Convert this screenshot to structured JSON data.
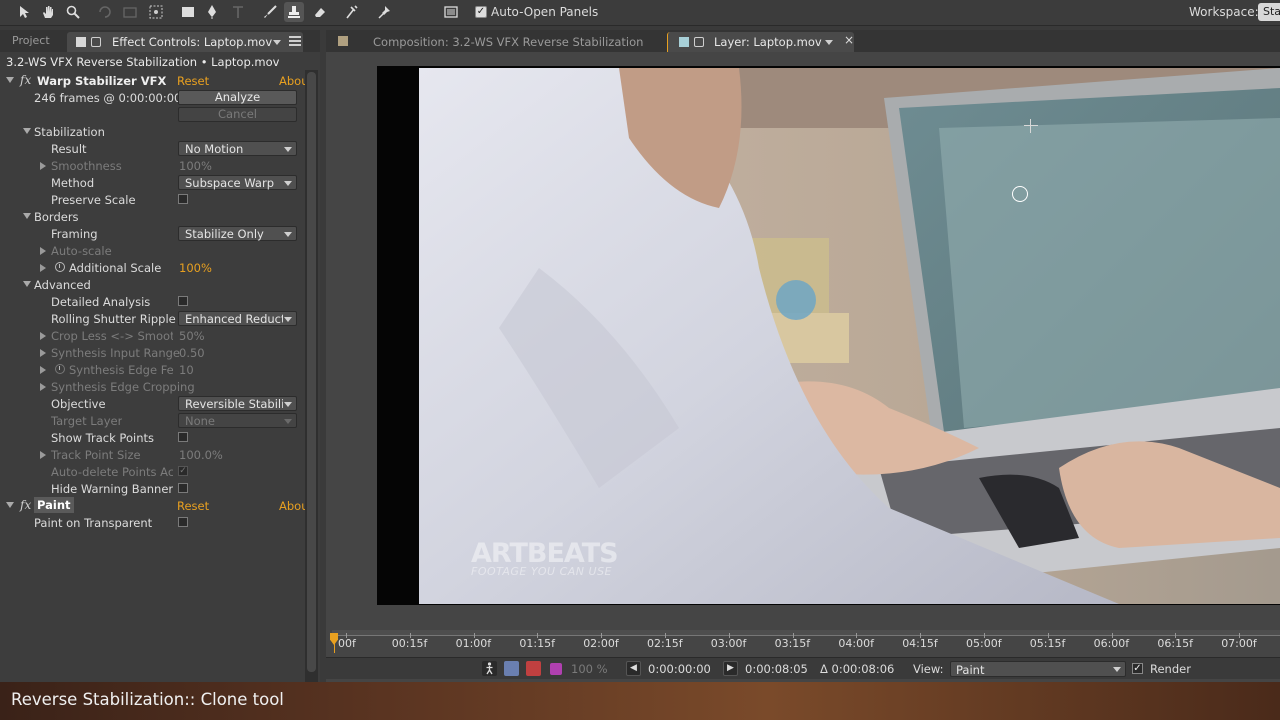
{
  "toolbar": {
    "auto_open_label": "Auto-Open Panels",
    "auto_open_checked": "✓",
    "workspace_label": "Workspace:",
    "workspace_value": "Sta"
  },
  "left_panel": {
    "project_tab": "Project",
    "effect_controls_tab": "Effect Controls: Laptop.mov",
    "header": "3.2-WS VFX Reverse Stabilization • Laptop.mov",
    "warp": {
      "name": "Warp Stabilizer VFX",
      "reset": "Reset",
      "about": "Abou",
      "frames_status": "246 frames @ 0:00:00:00",
      "analyze": "Analyze",
      "cancel": "Cancel"
    },
    "stabilization": {
      "label": "Stabilization",
      "result_label": "Result",
      "result_value": "No Motion",
      "smoothness_label": "Smoothness",
      "smoothness_value": "100%",
      "method_label": "Method",
      "method_value": "Subspace Warp",
      "preserve_scale_label": "Preserve Scale"
    },
    "borders": {
      "label": "Borders",
      "framing_label": "Framing",
      "framing_value": "Stabilize Only",
      "autoscale_label": "Auto-scale",
      "additional_scale_label": "Additional Scale",
      "additional_scale_value": "100%"
    },
    "advanced": {
      "label": "Advanced",
      "detailed_analysis_label": "Detailed Analysis",
      "rolling_shutter_label": "Rolling Shutter Ripple",
      "rolling_shutter_value": "Enhanced Reducti",
      "crop_less_label": "Crop Less <-> Smoot",
      "crop_less_value": "50%",
      "synth_input_label": "Synthesis Input Range",
      "synth_input_value": "0.50",
      "synth_edge_feather_label": "Synthesis Edge Fea",
      "synth_edge_feather_value": "10",
      "synth_edge_cropping_label": "Synthesis Edge Cropping",
      "objective_label": "Objective",
      "objective_value": "Reversible Stabiliz",
      "target_layer_label": "Target Layer",
      "target_layer_value": "None",
      "show_track_points_label": "Show Track Points",
      "track_point_size_label": "Track Point Size",
      "track_point_size_value": "100.0%",
      "auto_delete_label": "Auto-delete Points Acr",
      "auto_delete_check": "✓",
      "hide_warning_label": "Hide Warning Banner"
    },
    "paint": {
      "name": "Paint",
      "reset": "Reset",
      "about": "Abou",
      "paint_on_transparent_label": "Paint on Transparent"
    }
  },
  "right_panel": {
    "composition_tab": "Composition: 3.2-WS VFX Reverse Stabilization",
    "layer_tab": "Layer: Laptop.mov",
    "close": "×",
    "watermark_brand": "ARTBEATS",
    "watermark_tagline": "FOOTAGE YOU CAN USE",
    "timeline_ticks": [
      "00f",
      "00:15f",
      "01:00f",
      "01:15f",
      "02:00f",
      "02:15f",
      "03:00f",
      "03:15f",
      "04:00f",
      "04:15f",
      "05:00f",
      "05:15f",
      "06:00f",
      "06:15f",
      "07:00f",
      "0"
    ],
    "controls": {
      "opacity": "100 %",
      "in_time": "0:00:00:00",
      "out_time": "0:00:08:05",
      "duration": "Δ 0:00:08:06",
      "view_label": "View:",
      "view_value": "Paint",
      "render_label": "Render",
      "render_check": "✓"
    }
  },
  "caption": "Reverse Stabilization:: Clone tool",
  "colors": {
    "accent": "#e8a020",
    "panel_bg": "#3d3d3d",
    "viewer_bg": "#454545",
    "tab_bg": "#343434"
  }
}
